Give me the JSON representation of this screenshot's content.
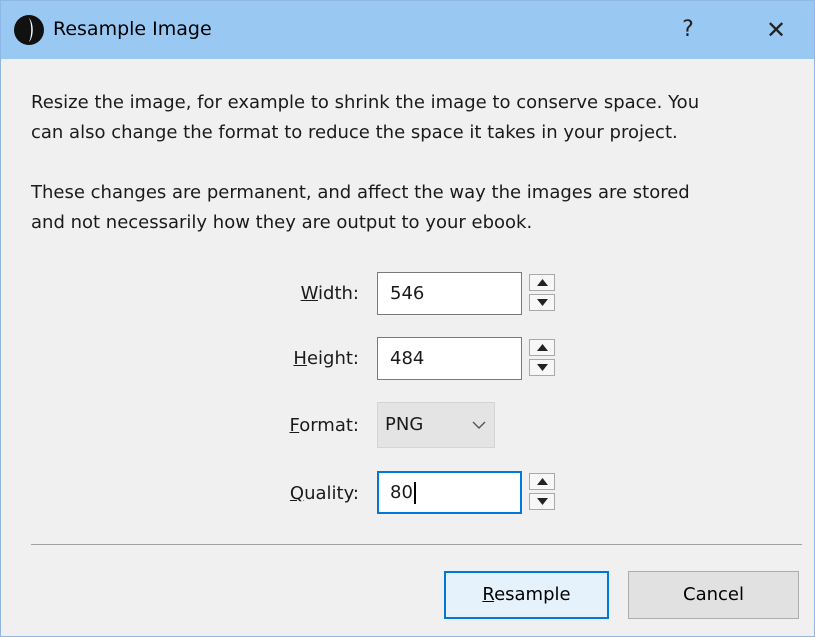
{
  "window": {
    "title": "Resample Image",
    "help_glyph": "?",
    "close_glyph": "✕",
    "app_icon": "quill-circle-icon"
  },
  "description": {
    "line1": "Resize the image, for example to shrink the image to conserve space. You",
    "line2": "can also change the format to reduce the space it takes in your project.",
    "line3": "These changes are permanent, and affect the way the images are stored",
    "line4": "and not necessarily how they are output to your ebook."
  },
  "fields": {
    "width": {
      "label_first": "W",
      "label_rest": "idth:",
      "value": "546"
    },
    "height": {
      "label_first": "H",
      "label_rest": "eight:",
      "value": "484"
    },
    "format": {
      "label_first": "F",
      "label_rest": "ormat:",
      "value": "PNG"
    },
    "quality": {
      "label_first": "Q",
      "label_rest": "uality:",
      "value": "80"
    }
  },
  "buttons": {
    "resample_first": "R",
    "resample_rest": "esample",
    "cancel": "Cancel"
  },
  "colors": {
    "titlebar": "#99c9f3",
    "focus_accent": "#0078d7",
    "dialog_bg": "#f0f0f0"
  }
}
